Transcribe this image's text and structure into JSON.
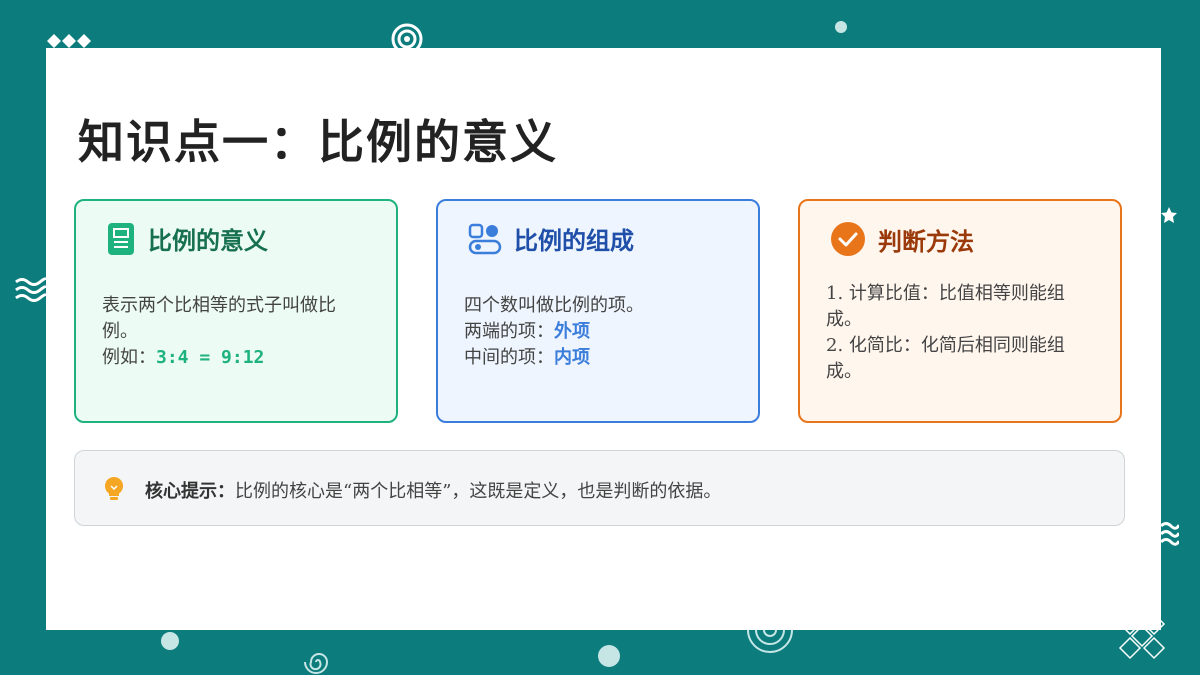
{
  "slide": {
    "title": "知识点一：比例的意义"
  },
  "cards": [
    {
      "title": "比例的意义",
      "icon": "document-icon",
      "color": "#1eb27e",
      "line1": "表示两个比相等的式子叫做比例。",
      "example_label": "例如：",
      "example_value": "3:4 = 9:12"
    },
    {
      "title": "比例的组成",
      "icon": "toggle-icon",
      "color": "#3b7ddb",
      "line1": "四个数叫做比例的项。",
      "outer_label": "两端的项：",
      "outer_value": "外项",
      "inner_label": "中间的项：",
      "inner_value": "内项"
    },
    {
      "title": "判断方法",
      "icon": "check-circle-icon",
      "color": "#e8751a",
      "step1": "1. 计算比值：比值相等则能组成。",
      "step2": "2. 化简比：化简后相同则能组成。"
    }
  ],
  "tip": {
    "icon": "lightbulb-icon",
    "label": "核心提示：",
    "text": "比例的核心是“两个比相等”，这既是定义，也是判断的依据。"
  },
  "colors": {
    "background": "#0c7c7c",
    "title": "#222222",
    "tip_bulb": "#f5a623"
  }
}
